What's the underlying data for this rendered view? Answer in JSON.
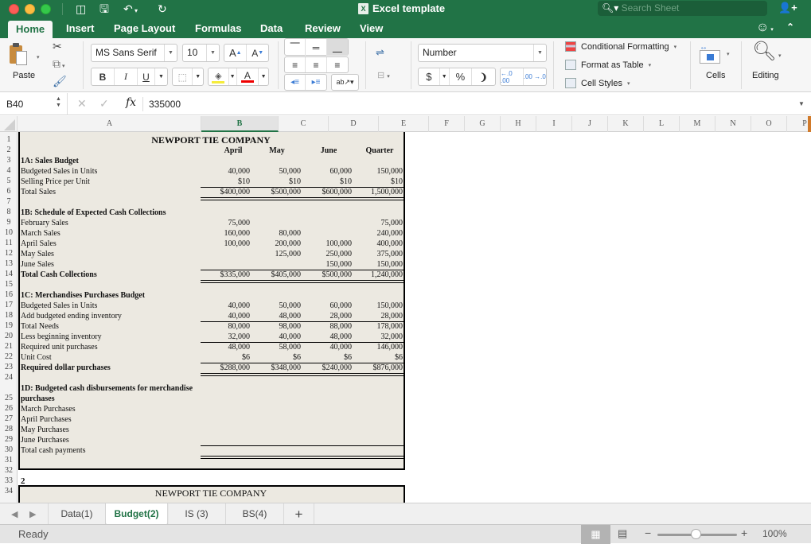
{
  "window": {
    "title": "Excel template",
    "search_placeholder": "Search Sheet"
  },
  "ribbon_tabs": [
    "Home",
    "Insert",
    "Page Layout",
    "Formulas",
    "Data",
    "Review",
    "View"
  ],
  "active_tab": "Home",
  "ribbon": {
    "paste_label": "Paste",
    "font_name": "MS Sans Serif",
    "font_size": "10",
    "bold": "B",
    "italic": "I",
    "underline": "U",
    "number_format": "Number",
    "currency": "$",
    "percent": "%",
    "comma": "❩",
    "inc_decimal": "←.0 .00",
    "dec_decimal": ".00 →.0",
    "conditional_formatting": "Conditional Formatting",
    "format_as_table": "Format as Table",
    "cell_styles": "Cell Styles",
    "cells_label": "Cells",
    "editing_label": "Editing"
  },
  "formula_bar": {
    "name_box": "B40",
    "fx": "fx",
    "value": "335000"
  },
  "columns": [
    "A",
    "B",
    "C",
    "D",
    "E",
    "F",
    "G",
    "H",
    "I",
    "J",
    "K",
    "L",
    "M",
    "N",
    "O",
    "P"
  ],
  "selected_column": "B",
  "rows": [
    "1",
    "2",
    "3",
    "4",
    "5",
    "6",
    "7",
    "8",
    "9",
    "10",
    "11",
    "12",
    "13",
    "14",
    "15",
    "16",
    "17",
    "18",
    "19",
    "20",
    "21",
    "22",
    "23",
    "24",
    "25",
    "26",
    "27",
    "28",
    "29",
    "30",
    "31",
    "32",
    "33",
    "34"
  ],
  "sheet": {
    "company": "NEWPORT TIE COMPANY",
    "headers": [
      "April",
      "May",
      "June",
      "Quarter"
    ],
    "sales_budget": {
      "title": "1A:  Sales Budget",
      "rows": [
        {
          "label": "Budgeted Sales in Units",
          "values": [
            "40,000",
            "50,000",
            "60,000",
            "150,000"
          ]
        },
        {
          "label": "Selling Price per Unit",
          "values": [
            "$10",
            "$10",
            "$10",
            "$10"
          ]
        },
        {
          "label": "Total Sales",
          "values": [
            "$400,000",
            "$500,000",
            "$600,000",
            "1,500,000"
          ]
        }
      ]
    },
    "cash_collections": {
      "title": "1B:  Schedule of Expected Cash Collections",
      "rows": [
        {
          "label": "February Sales",
          "values": [
            "75,000",
            "",
            "",
            "75,000"
          ]
        },
        {
          "label": "March Sales",
          "values": [
            "160,000",
            "80,000",
            "",
            "240,000"
          ]
        },
        {
          "label": "April Sales",
          "values": [
            "100,000",
            "200,000",
            "100,000",
            "400,000"
          ]
        },
        {
          "label": "May Sales",
          "values": [
            "",
            "125,000",
            "250,000",
            "375,000"
          ]
        },
        {
          "label": "June Sales",
          "values": [
            "",
            "",
            "150,000",
            "150,000"
          ]
        },
        {
          "label": "Total Cash Collections",
          "values": [
            "$335,000",
            "$405,000",
            "$500,000",
            "1,240,000"
          ]
        }
      ]
    },
    "purchases_budget": {
      "title": "1C:  Merchandises Purchases Budget",
      "rows": [
        {
          "label": "Budgeted Sales in Units",
          "values": [
            "40,000",
            "50,000",
            "60,000",
            "150,000"
          ]
        },
        {
          "label": "Add budgeted ending inventory",
          "values": [
            "40,000",
            "48,000",
            "28,000",
            "28,000"
          ]
        },
        {
          "label": "Total Needs",
          "values": [
            "80,000",
            "98,000",
            "88,000",
            "178,000"
          ]
        },
        {
          "label": "Less beginning inventory",
          "values": [
            "32,000",
            "40,000",
            "48,000",
            "32,000"
          ]
        },
        {
          "label": "Required unit purchases",
          "values": [
            "48,000",
            "58,000",
            "40,000",
            "146,000"
          ]
        },
        {
          "label": "Unit Cost",
          "values": [
            "$6",
            "$6",
            "$6",
            "$6"
          ]
        },
        {
          "label": "Required dollar purchases",
          "values": [
            "$288,000",
            "$348,000",
            "$240,000",
            "$876,000"
          ]
        }
      ]
    },
    "disbursements": {
      "title_line1": "1D:  Budgeted cash disbursements for merchandise",
      "title_line2": "purchases",
      "rows": [
        {
          "label": "March Purchases"
        },
        {
          "label": "April Purchases"
        },
        {
          "label": "May Purchases"
        },
        {
          "label": "June Purchases"
        },
        {
          "label": "Total cash payments"
        }
      ]
    },
    "section2_marker": "2",
    "section2_company": "NEWPORT TIE COMPANY"
  },
  "sheet_tabs": [
    "Data(1)",
    "Budget(2)",
    "IS (3)",
    "BS(4)"
  ],
  "active_sheet": "Budget(2)",
  "add_sheet": "+",
  "status": {
    "text": "Ready",
    "zoom": "100%",
    "zoom_percent": 100
  }
}
